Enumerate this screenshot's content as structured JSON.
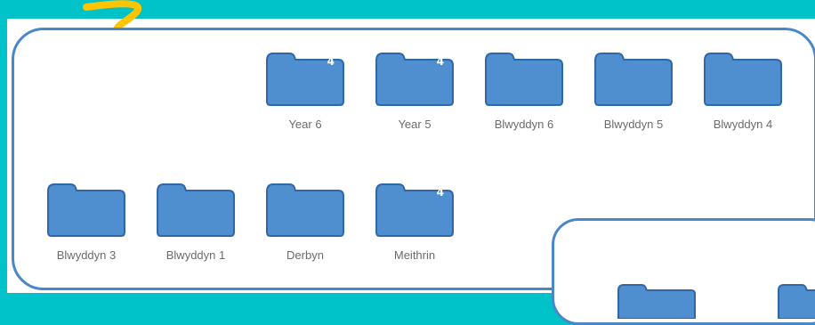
{
  "folders": [
    {
      "label": "Year 6",
      "badge": "4"
    },
    {
      "label": "Year 5",
      "badge": "4"
    },
    {
      "label": "Blwyddyn 6",
      "badge": ""
    },
    {
      "label": "Blwyddyn 5",
      "badge": ""
    },
    {
      "label": "Blwyddyn 4",
      "badge": ""
    },
    {
      "label": "Blwyddyn 3",
      "badge": ""
    },
    {
      "label": "Blwyddyn 1",
      "badge": ""
    },
    {
      "label": "Derbyn",
      "badge": ""
    },
    {
      "label": "Meithrin",
      "badge": "4"
    }
  ],
  "icons": {
    "folder": "folder-icon",
    "arrow": "curly-arrow-icon"
  },
  "colors": {
    "background": "#00c2c9",
    "folder_fill": "#4f8fcf",
    "folder_border": "#2f67a8",
    "panel_border": "#4a87c9",
    "arrow": "#ffc400",
    "label_text": "#6b6b6b"
  }
}
